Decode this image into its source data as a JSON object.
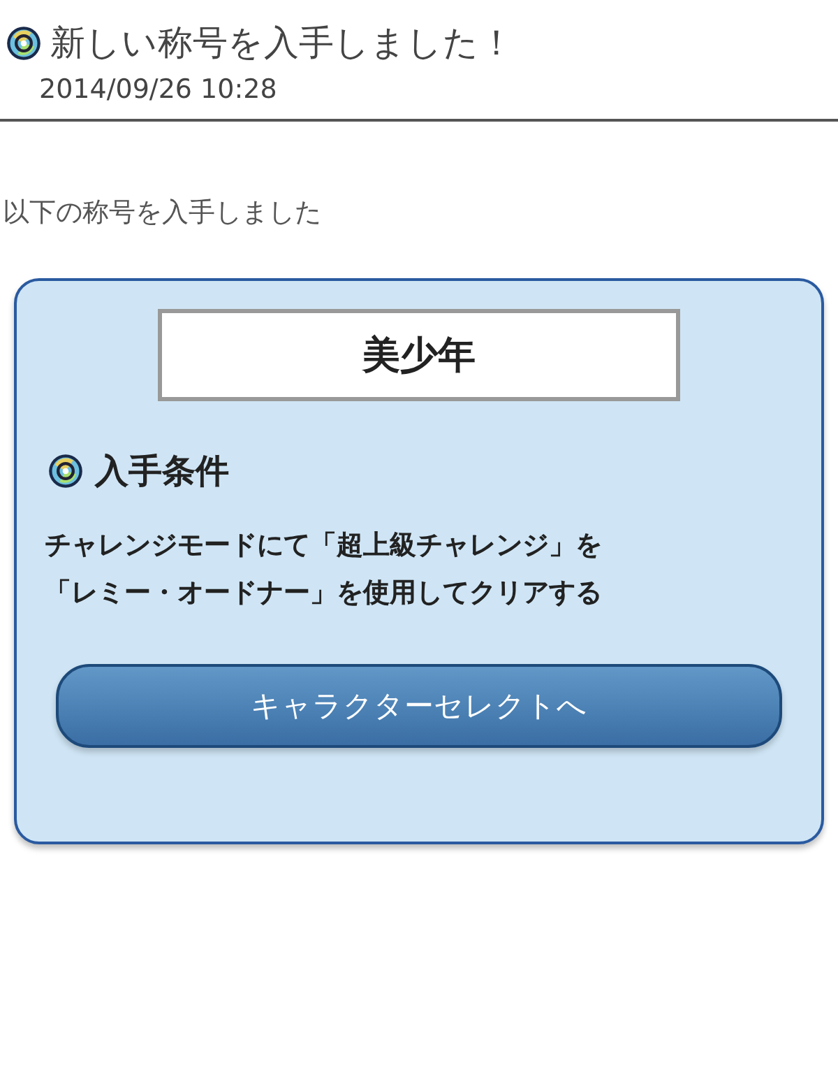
{
  "header": {
    "title": "新しい称号を入手しました！",
    "date": "2014/09/26 10:28"
  },
  "intro": "以下の称号を入手しました",
  "card": {
    "title_name": "美少年",
    "condition_heading": "入手条件",
    "condition_lines": [
      "チャレンジモードにて「超上級チャレンジ」を",
      "「レミー・オードナー」を使用してクリアする"
    ],
    "button": "キャラクターセレクトへ"
  }
}
